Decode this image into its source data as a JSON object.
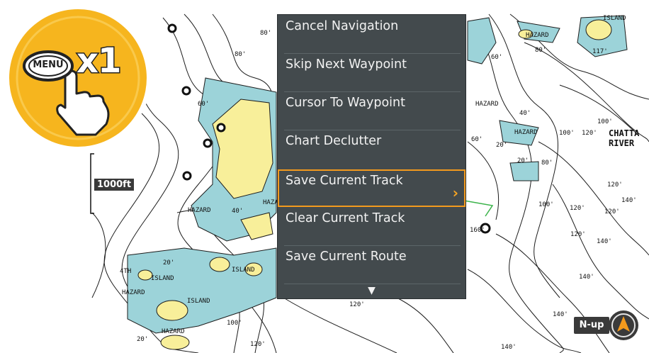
{
  "scale": {
    "label": "1000ft"
  },
  "orientation": {
    "label": "N-up"
  },
  "instruction": {
    "key_label": "MENU",
    "multiplier": "x1"
  },
  "menu": {
    "items": [
      {
        "label": "Cancel Navigation"
      },
      {
        "label": "Skip Next Waypoint"
      },
      {
        "label": "Cursor To Waypoint"
      },
      {
        "label": "Chart Declutter"
      },
      {
        "label": "Save Current Track",
        "selected": true
      },
      {
        "label": "Clear Current Track"
      },
      {
        "label": "Save Current Route"
      }
    ],
    "submenu_indicator": "›",
    "scroll_indicator": "▼"
  },
  "map_labels": {
    "d80a": "80'",
    "d80b": "80'",
    "d60a": "60'",
    "d60b": "60'",
    "d40a": "40'",
    "d40b": "40'",
    "d20a": "20'",
    "d20b": "20'",
    "d20c": "20'",
    "d100a": "100'",
    "d100b": "100'",
    "d100c": "100'",
    "d120a": "120'",
    "d120b": "120'",
    "d120c": "120'",
    "d120d": "120'",
    "d120e": "120'",
    "d140a": "140'",
    "d140b": "140'",
    "d140c": "140'",
    "d140d": "140'",
    "d160": "160'",
    "d80c": "80'",
    "d80d": "80'",
    "d60c": "60'",
    "d20d": "20'",
    "d117": "117'",
    "d4": "4TH",
    "hazard1": "HAZARD",
    "hazard2": "HAZARD",
    "hazard3": "HAZARD",
    "hazard4": "HAZARD",
    "hazard5": "HAZARD",
    "hazard6": "HAZARD",
    "hazard7": "HAZARD",
    "hazard8": "HAZARD",
    "island1": "ISLAND",
    "island2": "ISLAND",
    "island3": "ISLAND",
    "island4": "ISLAND",
    "river": "CHATTA\nRIVER"
  },
  "colors": {
    "menu_bg": "#434a4d",
    "highlight": "#f39a1d",
    "badge": "#f6b51e",
    "water": "#9cd3d9",
    "land": "#f8ef9a"
  }
}
